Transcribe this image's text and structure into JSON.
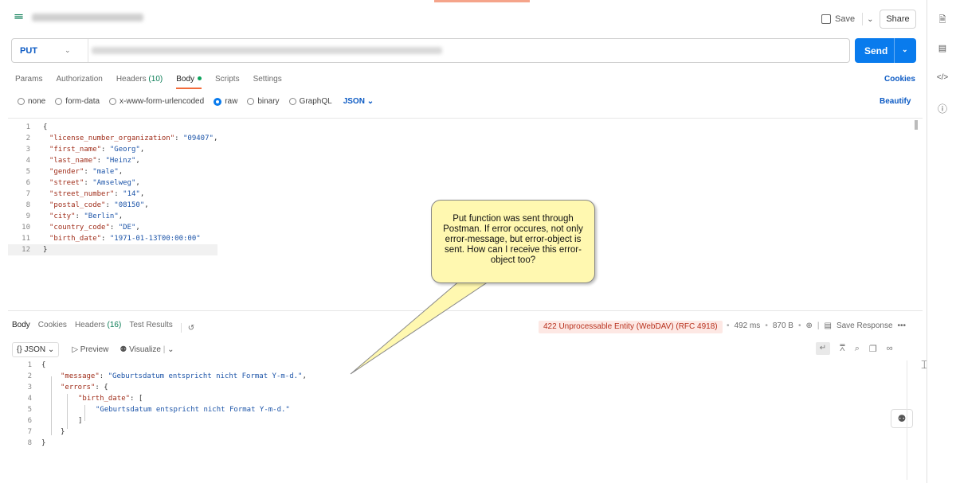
{
  "header": {
    "save_label": "Save",
    "share_label": "Share"
  },
  "request": {
    "method": "PUT",
    "send_label": "Send"
  },
  "request_tabs": [
    {
      "label": "Params"
    },
    {
      "label": "Authorization"
    },
    {
      "label": "Headers",
      "count": "(10)"
    },
    {
      "label": "Body"
    },
    {
      "label": "Scripts"
    },
    {
      "label": "Settings"
    }
  ],
  "cookies_label": "Cookies",
  "body_types": [
    "none",
    "form-data",
    "x-www-form-urlencoded",
    "raw",
    "binary",
    "GraphQL"
  ],
  "body_format": "JSON",
  "beautify_label": "Beautify",
  "request_body": {
    "line_numbers": [
      "1",
      "2",
      "3",
      "4",
      "5",
      "6",
      "7",
      "8",
      "9",
      "10",
      "11",
      "12"
    ],
    "lines": [
      {
        "key": "license_number_organization",
        "value": "09407"
      },
      {
        "key": "first_name",
        "value": "Georg"
      },
      {
        "key": "last_name",
        "value": "Heinz"
      },
      {
        "key": "gender",
        "value": "male"
      },
      {
        "key": "street",
        "value": "Amselweg"
      },
      {
        "key": "street_number",
        "value": "14"
      },
      {
        "key": "postal_code",
        "value": "08150"
      },
      {
        "key": "city",
        "value": "Berlin"
      },
      {
        "key": "country_code",
        "value": "DE"
      },
      {
        "key": "birth_date",
        "value": "1971-01-13T00:00:00"
      }
    ]
  },
  "response_tabs": [
    {
      "label": "Body"
    },
    {
      "label": "Cookies"
    },
    {
      "label": "Headers",
      "count": "(16)"
    },
    {
      "label": "Test Results"
    }
  ],
  "response_meta": {
    "status": "422 Unprocessable Entity (WebDAV) (RFC 4918)",
    "time": "492 ms",
    "size": "870 B",
    "save_response": "Save Response"
  },
  "response_toolbar": {
    "format": "JSON",
    "preview": "Preview",
    "visualize": "Visualize"
  },
  "response_body": {
    "line_numbers": [
      "1",
      "2",
      "3",
      "4",
      "5",
      "6",
      "7",
      "8"
    ],
    "message_key": "message",
    "message_value": "Geburtsdatum entspricht nicht Format Y-m-d.",
    "errors_key": "errors",
    "birth_date_key": "birth_date",
    "birth_date_error": "Geburtsdatum entspricht nicht Format Y-m-d."
  },
  "callout": {
    "text": "Put function was sent through Postman. If error occures, not only error-message, but error-object is sent. How can I receive this error-object too?"
  },
  "colors": {
    "accent": "#097bed",
    "active_tab": "#f26b3a",
    "status_error": "#b8321e",
    "callout_bg": "#fff8b0"
  }
}
